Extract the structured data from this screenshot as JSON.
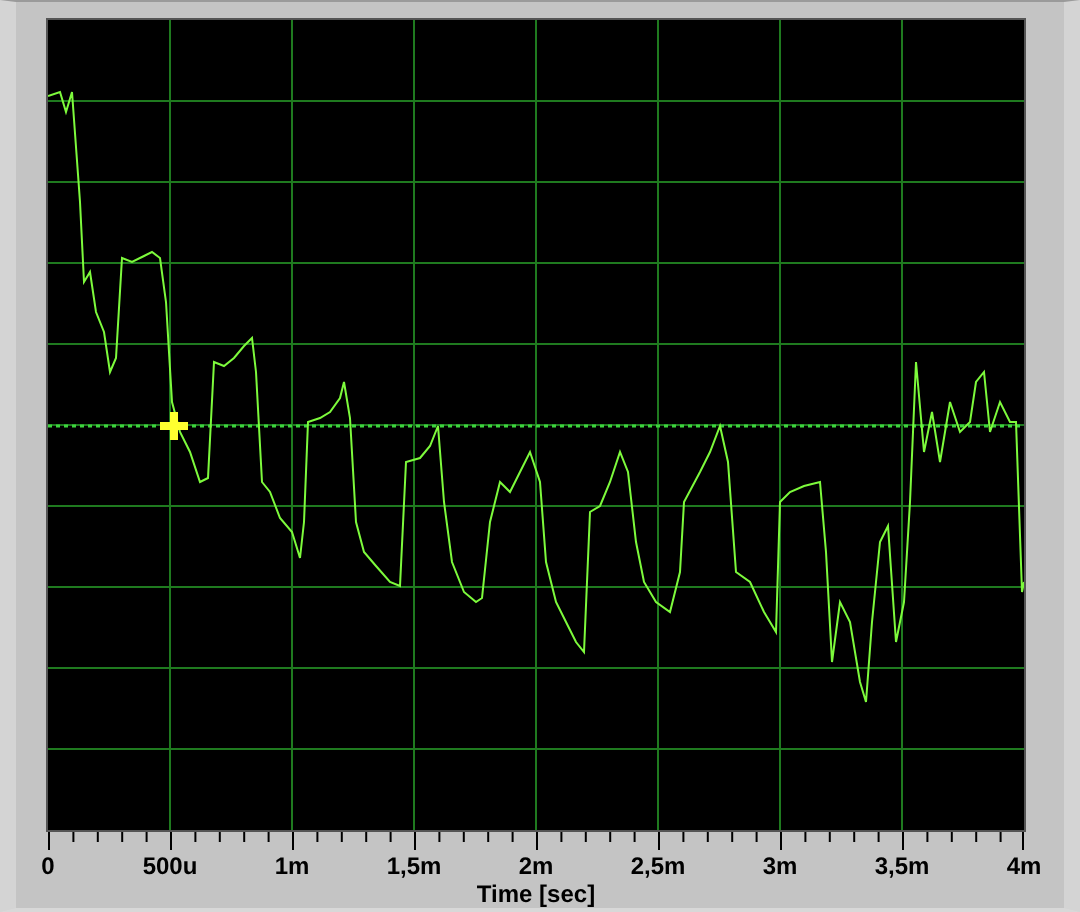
{
  "graph": {
    "x_axis": {
      "title": "Time [sec]",
      "tick_labels": [
        "0",
        "500u",
        "1m",
        "1,5m",
        "2m",
        "2,5m",
        "3m",
        "3,5m",
        "4m"
      ]
    }
  }
}
